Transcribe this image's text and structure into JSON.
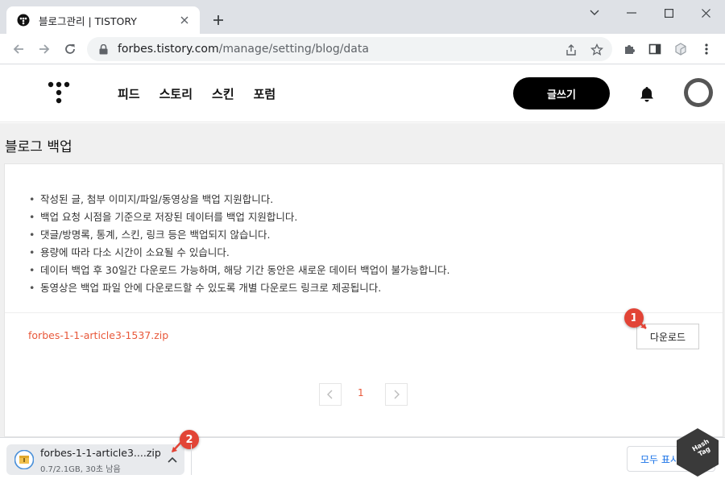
{
  "browser": {
    "tab_title": "블로그관리 | TISTORY",
    "url_host": "forbes.tistory.com",
    "url_path": "/manage/setting/blog/data"
  },
  "site": {
    "nav": [
      "피드",
      "스토리",
      "스킨",
      "포럼"
    ],
    "write_button": "글쓰기"
  },
  "page": {
    "heading": "블로그 백업",
    "notes": [
      "작성된 글, 첨부 이미지/파일/동영상을 백업 지원합니다.",
      "백업 요청 시점을 기준으로 저장된 데이터를 백업 지원합니다.",
      "댓글/방명록, 통계, 스킨, 링크 등은 백업되지 않습니다.",
      "용량에 따라 다소 시간이 소요될 수 있습니다.",
      "데이터 백업 후 30일간 다운로드 가능하며, 해당 기간 동안은 새로운 데이터 백업이 불가능합니다.",
      "동영상은 백업 파일 안에 다운로드할 수 있도록 개별 다운로드 링크로 제공됩니다."
    ],
    "backup_file": "forbes-1-1-article3-1537.zip",
    "download_button": "다운로드",
    "pagination": {
      "current_page": "1"
    }
  },
  "annotations": {
    "badge_1": "1",
    "badge_2": "2"
  },
  "downloads_shelf": {
    "file_name": "forbes-1-1-article3....zip",
    "status": "0.7/2.1GB, 30초 남음",
    "show_all": "모두 표시"
  },
  "watermark": {
    "text": "Hash Tag"
  },
  "colors": {
    "accent": "#e8583a",
    "badge": "#e24436",
    "write_button_bg": "#000000",
    "link_blue": "#1a73e8"
  },
  "icons": {
    "tab_favicon": "tistory-favicon-icon",
    "tab_close": "close-icon",
    "new_tab": "plus-icon",
    "back": "arrow-left-icon",
    "forward": "arrow-right-icon",
    "reload": "reload-icon",
    "lock": "lock-icon",
    "share": "share-icon",
    "bookmark": "star-icon",
    "extensions": "puzzle-icon",
    "side_panel": "sidepanel-icon",
    "profile": "profile-icon",
    "menu": "kebab-menu-icon",
    "notifications": "bell-icon",
    "download_file": "zip-file-icon",
    "download_options": "chevron-up-icon"
  }
}
